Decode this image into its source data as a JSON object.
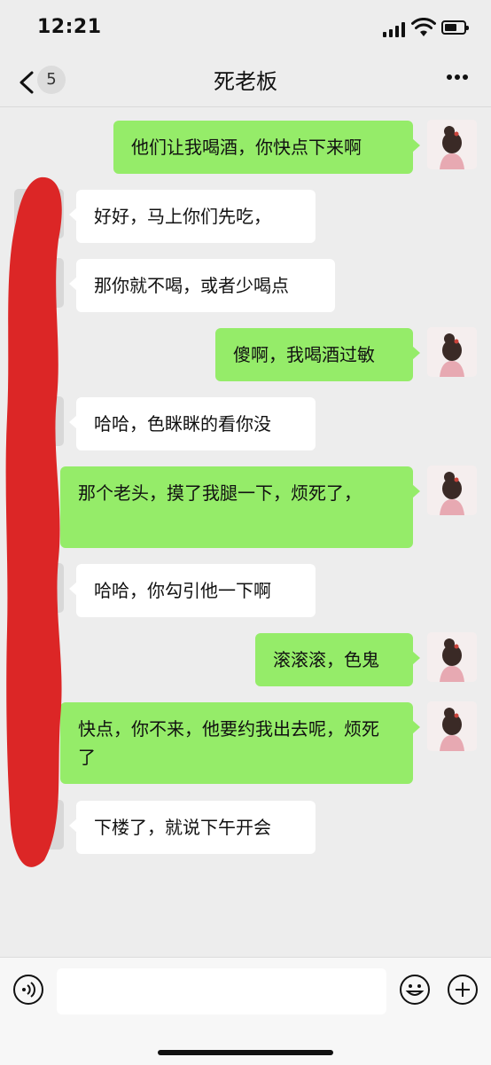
{
  "status": {
    "time": "12:21"
  },
  "nav": {
    "back_count": "5",
    "title": "死老板"
  },
  "messages": [
    {
      "side": "right",
      "text": "他们让我喝酒，你快点下来啊"
    },
    {
      "side": "left",
      "text": "好好，马上你们先吃，"
    },
    {
      "side": "left",
      "text": "那你就不喝，或者少喝点"
    },
    {
      "side": "right",
      "text": "傻啊，我喝酒过敏"
    },
    {
      "side": "left",
      "text": "哈哈，色眯眯的看你没"
    },
    {
      "side": "right",
      "text": "那个老头，摸了我腿一下，烦死了，"
    },
    {
      "side": "left",
      "text": "哈哈，你勾引他一下啊"
    },
    {
      "side": "right",
      "text": "滚滚滚，色鬼"
    },
    {
      "side": "right",
      "text": "快点，你不来，他要约我出去呢，烦死了"
    },
    {
      "side": "left",
      "text": "下楼了，就说下午开会"
    }
  ],
  "input": {
    "placeholder": ""
  },
  "colors": {
    "bubble_right": "#95ec69",
    "bubble_left": "#ffffff",
    "background": "#ededed",
    "scribble": "#dc2626"
  }
}
